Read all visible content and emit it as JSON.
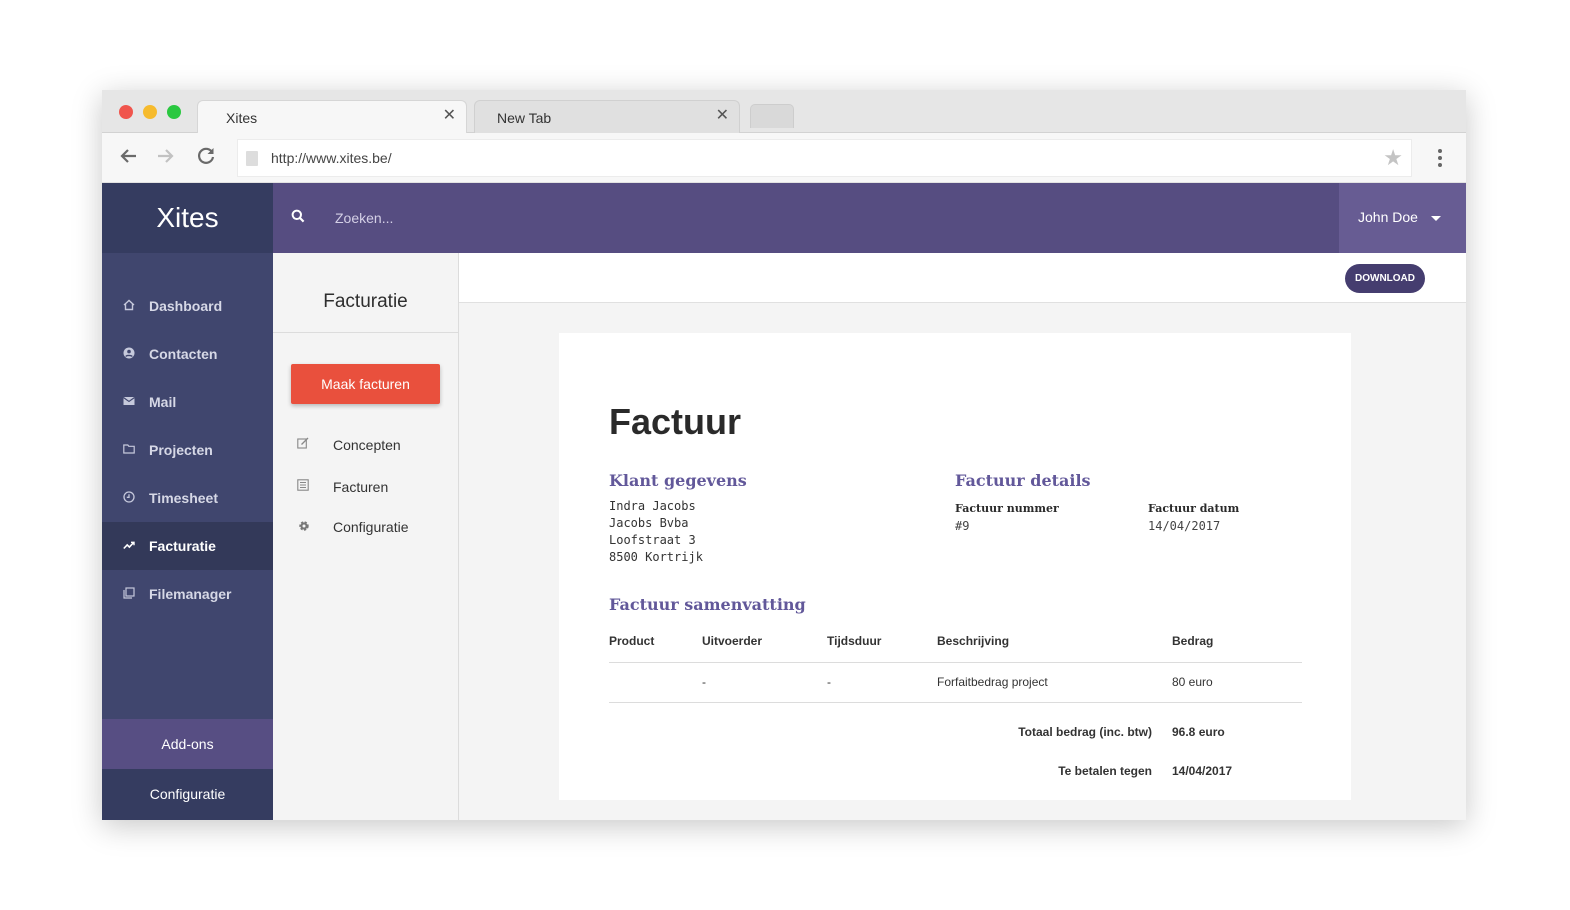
{
  "browser": {
    "tabs": [
      {
        "title": "Xites",
        "active": true
      },
      {
        "title": "New Tab",
        "active": false
      }
    ],
    "tab_close_glyph": "✕",
    "url": "http://www.xites.be/",
    "icons": {
      "back": "arrow-left-icon",
      "forward": "arrow-right-icon",
      "reload": "reload-icon",
      "star": "star-icon",
      "menu": "kebab-menu-icon"
    }
  },
  "app": {
    "brand": "Xites",
    "search": {
      "placeholder": "Zoeken..."
    },
    "user": {
      "name": "John Doe"
    },
    "colors": {
      "topbar": "#564d81",
      "sidebar": "#40466e",
      "brand": "#353c60",
      "primary_button": "#e9503d",
      "accent_heading": "#62589a"
    }
  },
  "sidebar": {
    "items": [
      {
        "label": "Dashboard",
        "icon": "home-icon",
        "active": false
      },
      {
        "label": "Contacten",
        "icon": "user-circle-icon",
        "active": false
      },
      {
        "label": "Mail",
        "icon": "envelope-icon",
        "active": false
      },
      {
        "label": "Projecten",
        "icon": "folder-icon",
        "active": false
      },
      {
        "label": "Timesheet",
        "icon": "clock-icon",
        "active": false
      },
      {
        "label": "Facturatie",
        "icon": "trend-up-icon",
        "active": true
      },
      {
        "label": "Filemanager",
        "icon": "files-icon",
        "active": false
      }
    ],
    "addons": "Add-ons",
    "configuratie": "Configuratie"
  },
  "subnav": {
    "title": "Facturatie",
    "primary_button": "Maak facturen",
    "items": [
      {
        "label": "Concepten",
        "icon": "edit-icon"
      },
      {
        "label": "Facturen",
        "icon": "list-icon"
      },
      {
        "label": "Configuratie",
        "icon": "gear-icon"
      }
    ]
  },
  "content": {
    "download_label": "DOWNLOAD"
  },
  "invoice": {
    "title": "Factuur",
    "client": {
      "heading": "Klant gegevens",
      "lines": [
        "Indra Jacobs",
        "Jacobs Bvba",
        "Loofstraat 3",
        "8500 Kortrijk"
      ]
    },
    "details": {
      "heading": "Factuur details",
      "number_label": "Factuur nummer",
      "number_value": "#9",
      "date_label": "Factuur datum",
      "date_value": "14/04/2017"
    },
    "summary": {
      "heading": "Factuur samenvatting",
      "columns": [
        "Product",
        "Uitvoerder",
        "Tijdsduur",
        "Beschrijving",
        "Bedrag"
      ],
      "rows": [
        {
          "product": "",
          "uitvoerder": "-",
          "tijdsduur": "-",
          "beschrijving": "Forfaitbedrag project",
          "bedrag": "80 euro"
        }
      ],
      "total_label": "Totaal bedrag (inc. btw)",
      "total_value": "96.8 euro",
      "due_label": "Te betalen tegen",
      "due_value": "14/04/2017"
    }
  }
}
